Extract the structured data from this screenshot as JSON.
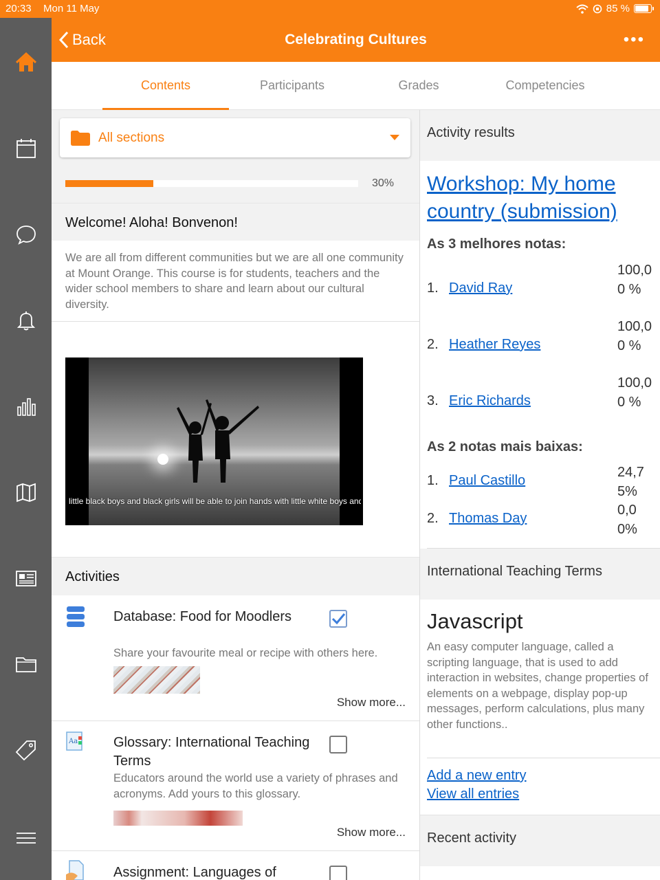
{
  "status": {
    "time": "20:33",
    "date": "Mon 11 May",
    "battery": "85 %"
  },
  "nav": {
    "back_label": "Back",
    "title": "Celebrating Cultures",
    "more_label": "•••"
  },
  "sidebar": {
    "items": [
      "home-icon",
      "calendar-icon",
      "messages-icon",
      "notifications-icon",
      "grades-icon",
      "map-icon",
      "news-icon",
      "files-icon",
      "tag-icon",
      "menu-icon"
    ]
  },
  "tabs": [
    {
      "label": "Contents",
      "active": true
    },
    {
      "label": "Participants",
      "active": false
    },
    {
      "label": "Grades",
      "active": false
    },
    {
      "label": "Competencies",
      "active": false
    }
  ],
  "section": {
    "label": "All sections",
    "progress_percent": 30,
    "progress_label": "30%"
  },
  "welcome": {
    "title": "Welcome! Aloha! Bonvenon!",
    "text": "We are all from different communities but we are all one community at Mount Orange. This course is for students, teachers and the wider school members to share and learn about our cultural diversity.",
    "image_caption": "little black boys and black girls will be able to join hands with little white boys and white girls"
  },
  "activities": {
    "title": "Activities",
    "items": [
      {
        "title": "Database: Food for Moodlers",
        "description": "Share your favourite meal or recipe with others here.",
        "completed": true,
        "more": "Show more..."
      },
      {
        "title": "Glossary: International Teaching Terms",
        "description": "Educators around the world use a variety of phrases and acronyms. Add yours to this glossary.",
        "completed": false,
        "more": "Show more..."
      },
      {
        "title": "Assignment: Languages of",
        "completed": false
      }
    ]
  },
  "activity_results": {
    "header": "Activity results",
    "link": "Workshop: My home country (submission)",
    "top_heading": "As 3 melhores notas:",
    "top": [
      {
        "rank": "1.",
        "name": "David Ray",
        "grade": "100,00 %"
      },
      {
        "rank": "2.",
        "name": "Heather Reyes",
        "grade": "100,00 %"
      },
      {
        "rank": "3.",
        "name": "Eric Richards",
        "grade": "100,00 %"
      }
    ],
    "bottom_heading": "As 2 notas mais baixas:",
    "bottom": [
      {
        "rank": "1.",
        "name": "Paul Castillo",
        "grade": "24,75%"
      },
      {
        "rank": "2.",
        "name": "Thomas Day",
        "grade": "0,00%"
      }
    ]
  },
  "glossary_block": {
    "header": "International Teaching Terms",
    "term": "Javascript",
    "definition": "An easy computer language, called a scripting language, that is used to add interaction in websites, change properties of elements on a webpage, display pop-up messages, perform calculations, plus many other functions..",
    "add_link": "Add a new entry",
    "view_link": "View all entries"
  },
  "recent_activity": {
    "header": "Recent activity"
  },
  "colors": {
    "brand": "#f98012",
    "sidebar": "#5c5c5c",
    "link": "#0a62c9"
  }
}
